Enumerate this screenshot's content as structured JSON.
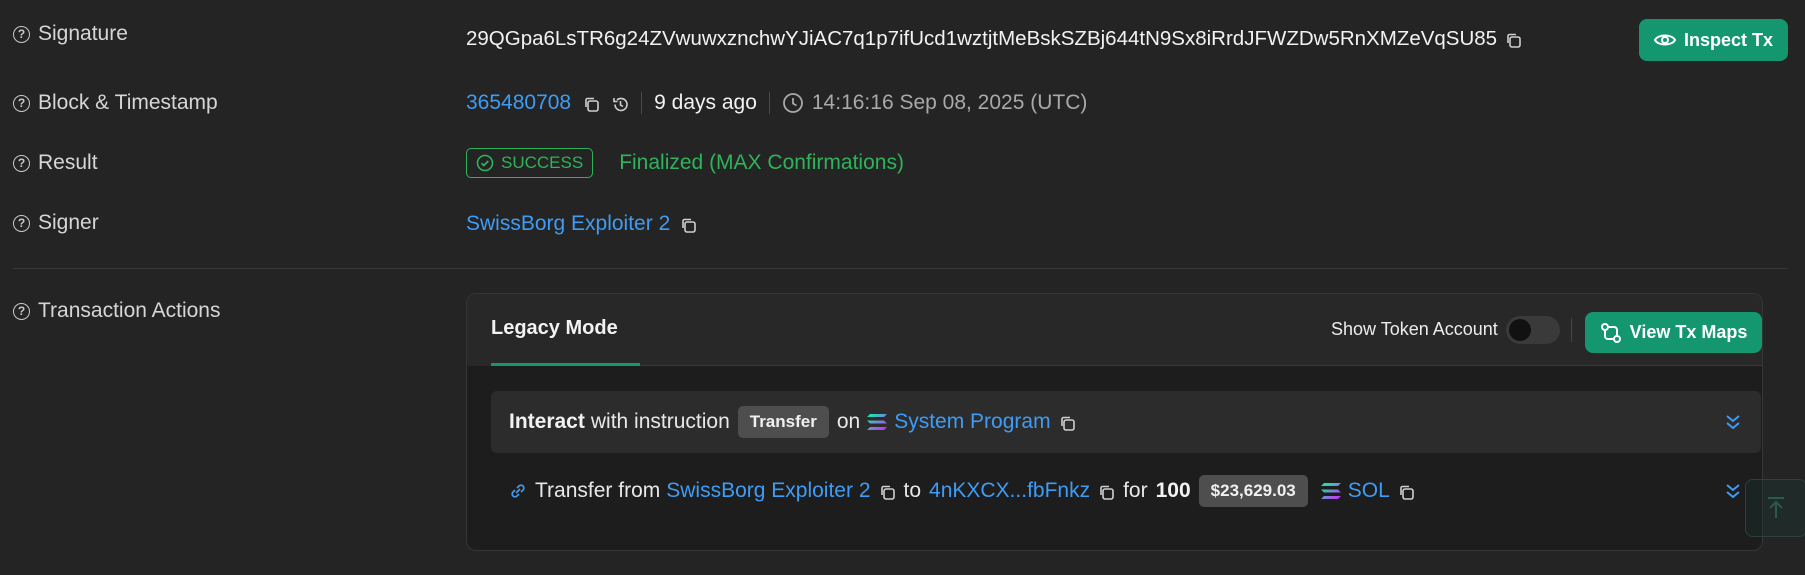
{
  "rows": {
    "signature": {
      "label": "Signature",
      "value": "29QGpa6LsTR6g24ZVwuwxznchwYJiAC7q1p7ifUcd1wztjtMeBskSZBj644tN9Sx8iRrdJFWZDw5RnXMZeVqSU85"
    },
    "block": {
      "label": "Block & Timestamp",
      "block_number": "365480708",
      "age": "9 days ago",
      "timestamp": "14:16:16 Sep 08, 2025 (UTC)"
    },
    "result": {
      "label": "Result",
      "status": "SUCCESS",
      "finality": "Finalized (MAX Confirmations)"
    },
    "signer": {
      "label": "Signer",
      "value": "SwissBorg Exploiter 2"
    },
    "actions": {
      "label": "Transaction Actions"
    }
  },
  "inspect_button": "Inspect Tx",
  "panel": {
    "tab": "Legacy Mode",
    "toggle_label": "Show Token Account",
    "view_maps_button": "View Tx Maps",
    "instruction": {
      "bold": "Interact",
      "text": "with instruction",
      "type": "Transfer",
      "on": "on",
      "program": "System Program"
    },
    "transfer": {
      "text": "Transfer from",
      "from": "SwissBorg Exploiter 2",
      "to_word": "to",
      "to": "4nKXCX...fbFnkz",
      "for_word": "for",
      "amount": "100",
      "usd": "$23,629.03",
      "token": "SOL"
    }
  },
  "colors": {
    "accent_green": "#14966f",
    "link_blue": "#3f9cf5",
    "success_green": "#2fb35a"
  }
}
